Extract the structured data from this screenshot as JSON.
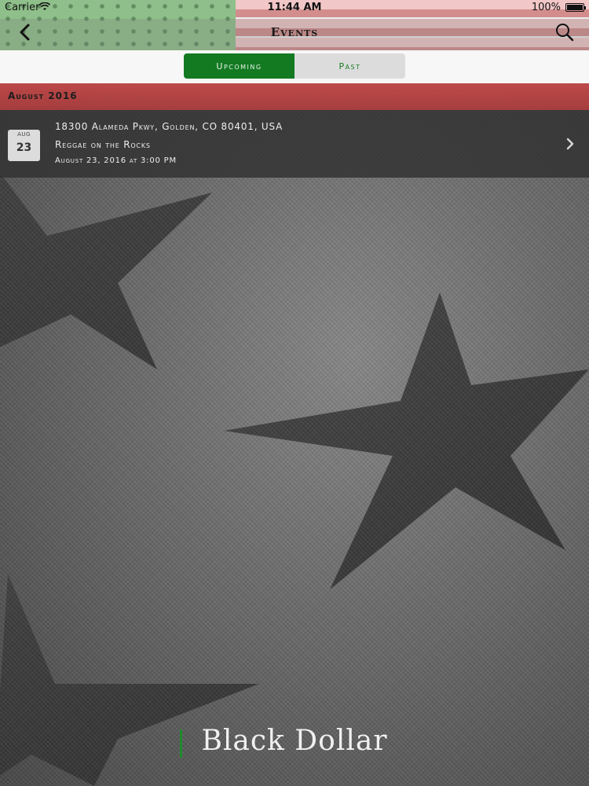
{
  "status_bar": {
    "carrier": "Carrier",
    "time": "11:44 AM",
    "battery": "100%"
  },
  "nav": {
    "title": "Events",
    "back_icon": "chevron-left-icon",
    "search_icon": "search-icon"
  },
  "segments": {
    "upcoming": "Upcoming",
    "past": "Past",
    "selected": "Upcoming"
  },
  "section": {
    "label": "August 2016"
  },
  "events": [
    {
      "badge_month": "AUG",
      "badge_day": "23",
      "address": "18300 Alameda Pkwy, Golden, CO 80401, USA",
      "title": "Reggae on the Rocks",
      "datetime": "August 23, 2016 at 3:00 PM"
    }
  ],
  "logo": {
    "text": "Black Dollar"
  },
  "colors": {
    "accent_green": "#137a22",
    "section_red": "#b34242",
    "row_dark": "#323232"
  }
}
